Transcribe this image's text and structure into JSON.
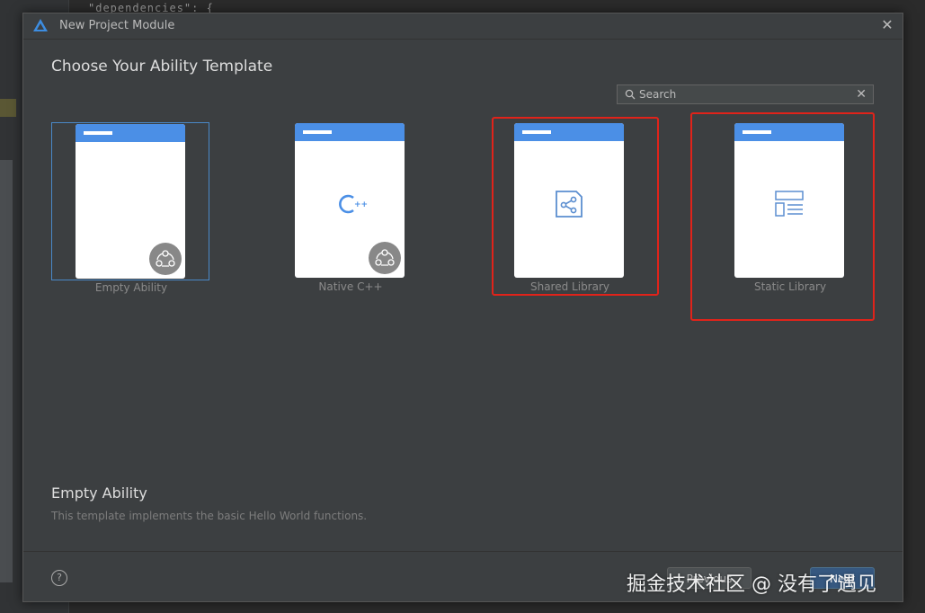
{
  "background": {
    "code_snippet": "\"dependencies\": {"
  },
  "dialog": {
    "title": "New Project Module",
    "close_icon": "close-icon"
  },
  "main": {
    "heading": "Choose Your Ability Template",
    "search": {
      "placeholder": "Search",
      "value": ""
    },
    "templates": [
      {
        "label": "Empty Ability",
        "selected": true,
        "icon": "harmony-badge-icon",
        "highlighted": false
      },
      {
        "label": "Native C++",
        "selected": false,
        "icon": "cpp-icon",
        "highlighted": false
      },
      {
        "label": "Shared Library",
        "selected": false,
        "icon": "share-icon",
        "highlighted": true
      },
      {
        "label": "Static Library",
        "selected": false,
        "icon": "layout-icon",
        "highlighted": true
      }
    ],
    "description": {
      "title": "Empty Ability",
      "text": "This template implements the basic Hello World functions."
    }
  },
  "footer": {
    "help_label": "?",
    "previous_label": "Previous",
    "next_label": "Next"
  },
  "watermark": "掘金技术社区 @ 没有了遇见",
  "colors": {
    "accent": "#4b8fe6",
    "selected_border": "#4a88c7",
    "highlight_red": "#e0231a",
    "dialog_bg": "#3c3f41"
  }
}
